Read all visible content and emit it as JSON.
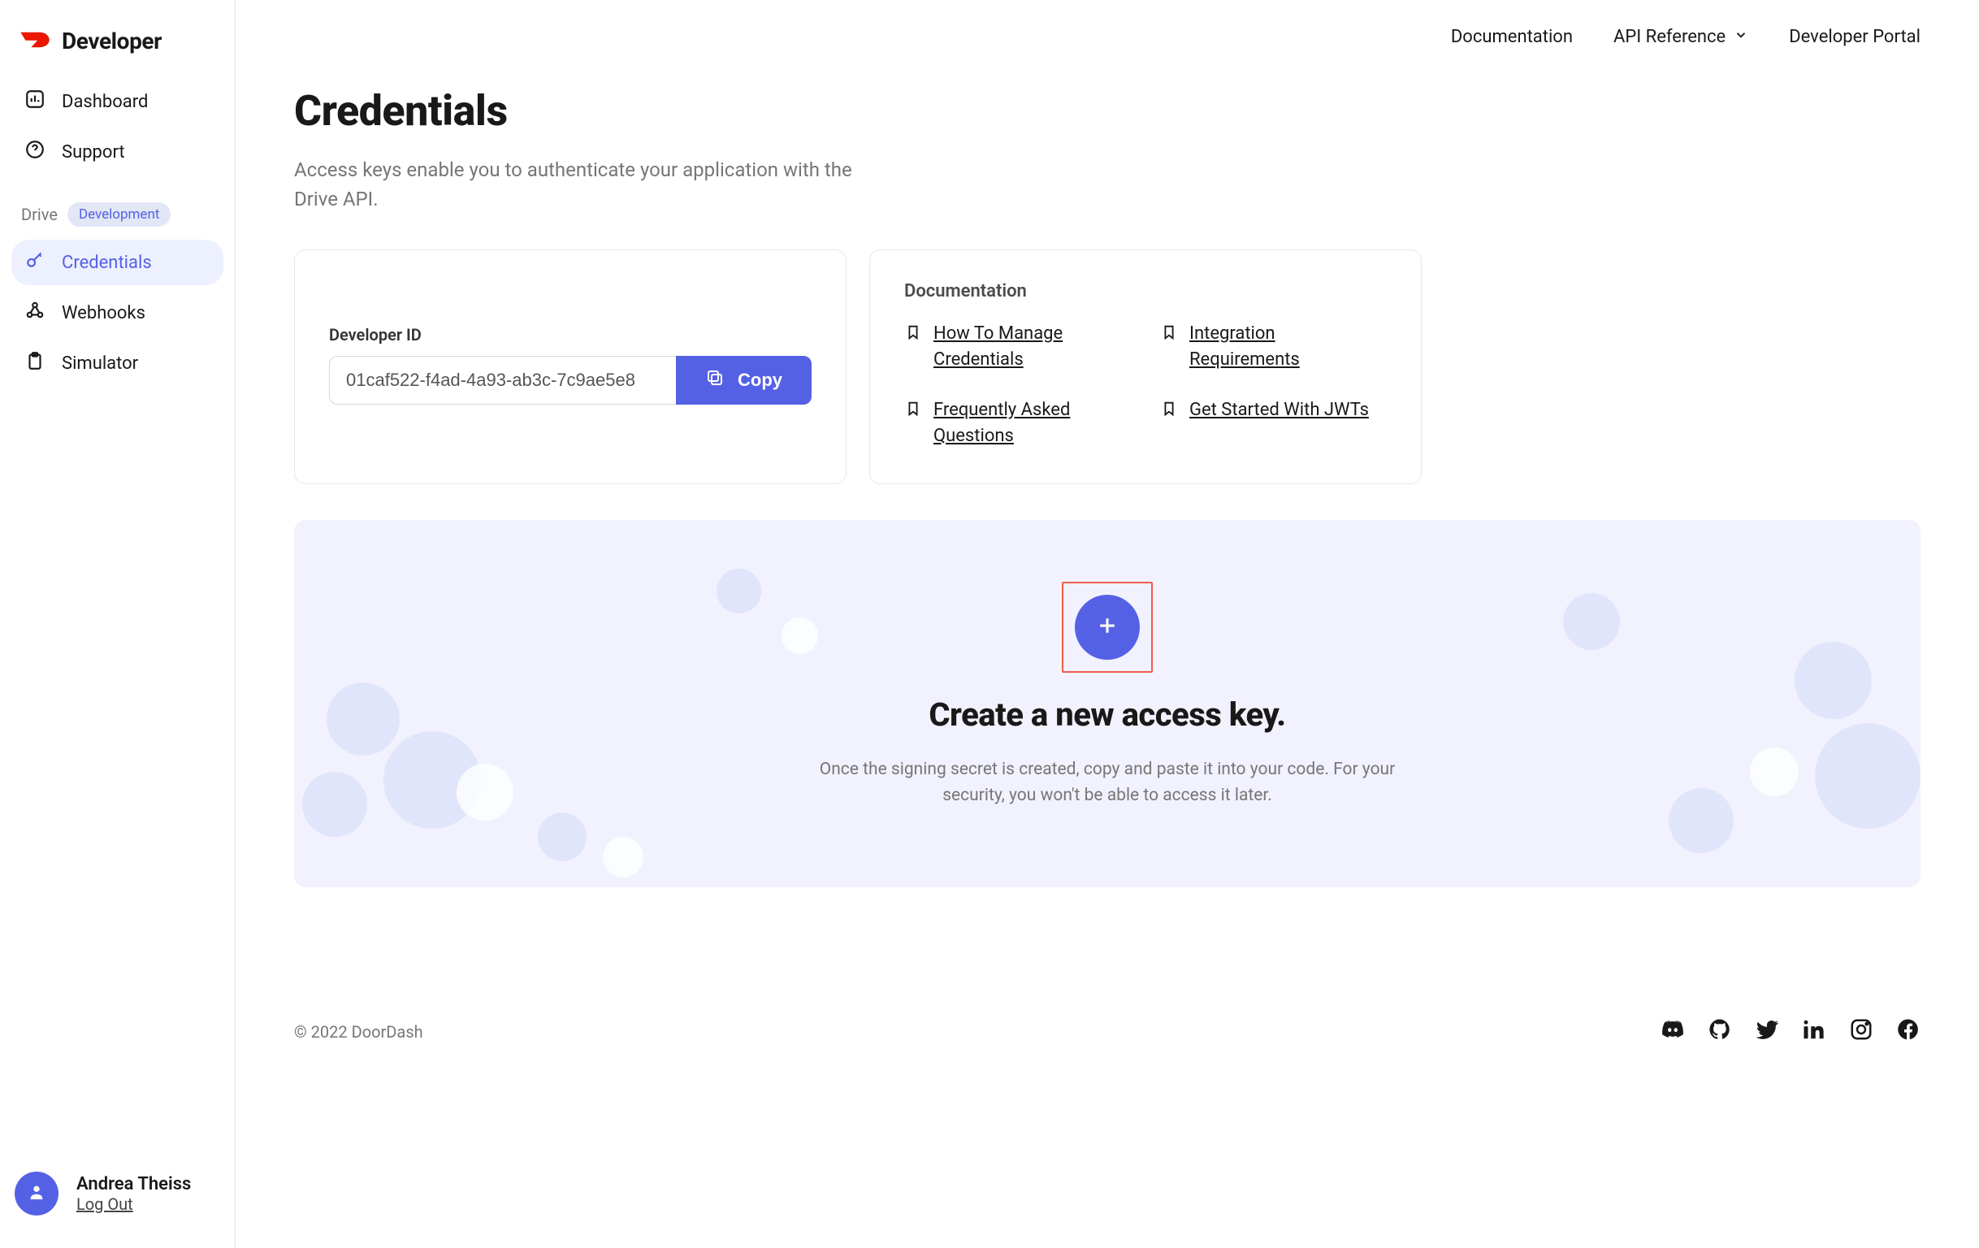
{
  "brand": {
    "name": "Developer"
  },
  "sidebar": {
    "items": [
      {
        "label": "Dashboard"
      },
      {
        "label": "Support"
      }
    ],
    "section": {
      "label": "Drive",
      "badge": "Development"
    },
    "drive_items": [
      {
        "label": "Credentials"
      },
      {
        "label": "Webhooks"
      },
      {
        "label": "Simulator"
      }
    ]
  },
  "topnav": {
    "documentation": "Documentation",
    "api_reference": "API Reference",
    "developer_portal": "Developer Portal"
  },
  "page": {
    "title": "Credentials",
    "subtitle": "Access keys enable you to authenticate your application with the Drive API."
  },
  "dev_id": {
    "label": "Developer ID",
    "value": "01caf522-f4ad-4a93-ab3c-7c9ae5e8",
    "copy_label": "Copy"
  },
  "docs": {
    "title": "Documentation",
    "links": [
      "How To Manage Credentials",
      "Integration Requirements",
      "Frequently Asked Questions",
      "Get Started With JWTs"
    ]
  },
  "create": {
    "title": "Create a new access key.",
    "subtitle": "Once the signing secret is created, copy and paste it into your code. For your security, you won't be able to access it later."
  },
  "user": {
    "name": "Andrea Theiss",
    "logout": "Log Out"
  },
  "footer": {
    "copyright": "© 2022 DoorDash"
  }
}
